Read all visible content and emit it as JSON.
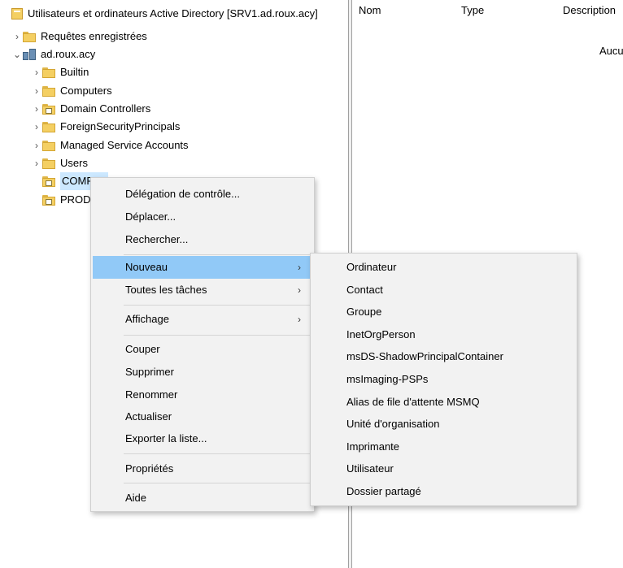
{
  "tree": {
    "root_label": "Utilisateurs et ordinateurs Active Directory [SRV1.ad.roux.acy]",
    "items": [
      {
        "label": "Requêtes enregistrées",
        "chevron": "›"
      },
      {
        "label": "ad.roux.acy",
        "chevron": "⌄"
      },
      {
        "label": "Builtin",
        "chevron": "›"
      },
      {
        "label": "Computers",
        "chevron": "›"
      },
      {
        "label": "Domain Controllers",
        "chevron": "›"
      },
      {
        "label": "ForeignSecurityPrincipals",
        "chevron": "›"
      },
      {
        "label": "Managed Service Accounts",
        "chevron": "›"
      },
      {
        "label": "Users",
        "chevron": "›"
      },
      {
        "label": "COMPTA",
        "chevron": ""
      },
      {
        "label": "PROD",
        "chevron": ""
      }
    ]
  },
  "list": {
    "columns": [
      "Nom",
      "Type",
      "Description"
    ],
    "empty_text": "Aucun élément à afficher dans cet affichage."
  },
  "context_menu": {
    "items": [
      {
        "label": "Délégation de contrôle..."
      },
      {
        "label": "Déplacer..."
      },
      {
        "label": "Rechercher..."
      },
      {
        "label": "Nouveau",
        "arrow": "›"
      },
      {
        "label": "Toutes les tâches",
        "arrow": "›"
      },
      {
        "label": "Affichage",
        "arrow": "›"
      },
      {
        "label": "Couper"
      },
      {
        "label": "Supprimer"
      },
      {
        "label": "Renommer"
      },
      {
        "label": "Actualiser"
      },
      {
        "label": "Exporter la liste..."
      },
      {
        "label": "Propriétés"
      },
      {
        "label": "Aide"
      }
    ]
  },
  "submenu": {
    "items": [
      {
        "label": "Ordinateur"
      },
      {
        "label": "Contact"
      },
      {
        "label": "Groupe"
      },
      {
        "label": "InetOrgPerson"
      },
      {
        "label": "msDS-ShadowPrincipalContainer"
      },
      {
        "label": "msImaging-PSPs"
      },
      {
        "label": "Alias de file d'attente MSMQ"
      },
      {
        "label": "Unité d'organisation"
      },
      {
        "label": "Imprimante"
      },
      {
        "label": "Utilisateur"
      },
      {
        "label": "Dossier partagé"
      }
    ]
  },
  "colors": {
    "highlight": "#91c9f7",
    "selection": "#cce8ff",
    "menu_bg": "#f2f2f2"
  }
}
